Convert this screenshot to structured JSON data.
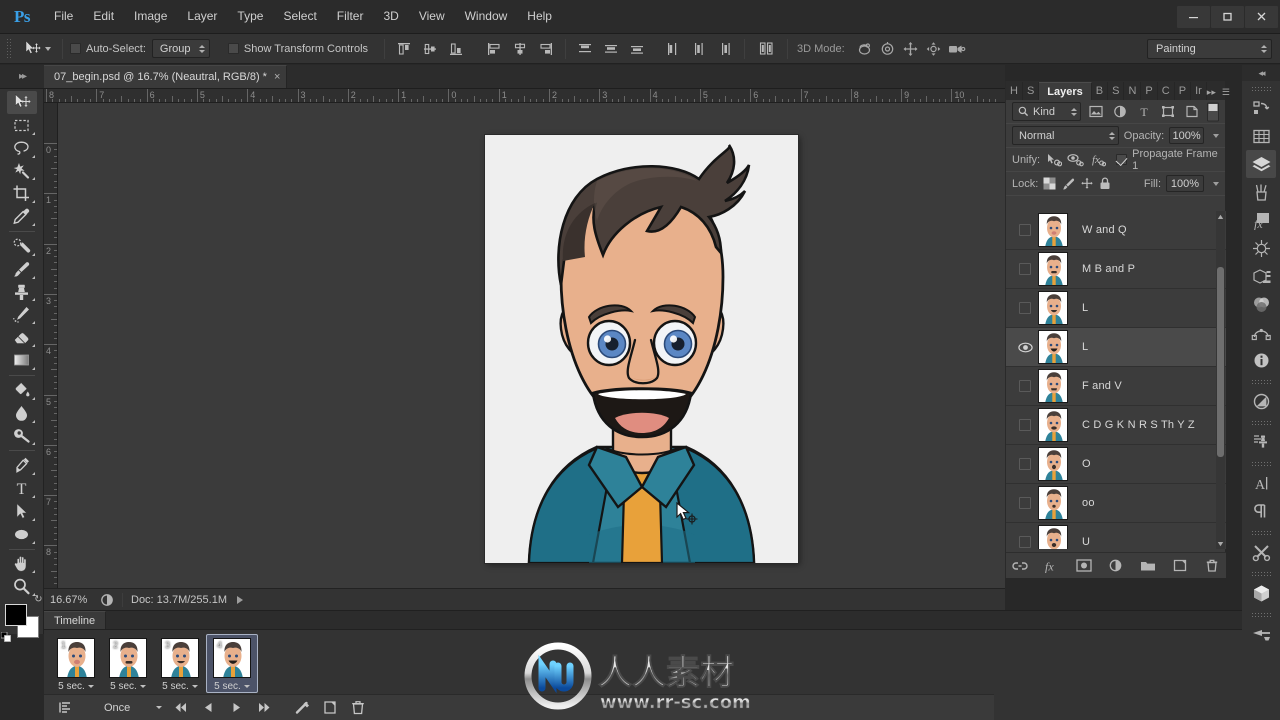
{
  "app": {
    "name": "Adobe Photoshop",
    "logo_text": "Ps"
  },
  "menubar": {
    "items": [
      {
        "label": "File"
      },
      {
        "label": "Edit"
      },
      {
        "label": "Image"
      },
      {
        "label": "Layer"
      },
      {
        "label": "Type"
      },
      {
        "label": "Select"
      },
      {
        "label": "Filter"
      },
      {
        "label": "3D"
      },
      {
        "label": "View"
      },
      {
        "label": "Window"
      },
      {
        "label": "Help"
      }
    ]
  },
  "window_controls": {
    "minimize": "minimize-icon",
    "maximize": "maximize-icon",
    "close": "close-icon"
  },
  "options_bar": {
    "tool": "move-tool",
    "auto_select_checked": false,
    "auto_select_label": "Auto-Select:",
    "auto_select_value": "Group",
    "show_transform_checked": false,
    "show_transform_label": "Show Transform Controls",
    "align_buttons": [
      "align-top-edges",
      "align-vertical-centers",
      "align-bottom-edges",
      "align-left-edges",
      "align-horizontal-centers",
      "align-right-edges"
    ],
    "distribute_buttons": [
      "distribute-top-edges",
      "distribute-vertical-centers",
      "distribute-bottom-edges",
      "distribute-left-edges",
      "distribute-horizontal-centers",
      "distribute-right-edges"
    ],
    "auto_align_button": "auto-align-layers",
    "mode3d_label": "3D Mode:",
    "mode3d_buttons": [
      "orbit-3d",
      "roll-3d",
      "pan-3d",
      "slide-3d",
      "zoom-3d-camera"
    ],
    "workspace": "Painting"
  },
  "document": {
    "tab_title": "07_begin.psd @ 16.7% (Neautral, RGB/8) *",
    "close_glyph": "×"
  },
  "rulers": {
    "unit_hint": "inches",
    "horizontal_labels": [
      "8",
      "7",
      "6",
      "5",
      "4",
      "3",
      "2",
      "1",
      "0",
      "1",
      "2",
      "3",
      "4",
      "5",
      "6",
      "7",
      "8",
      "9",
      "10"
    ],
    "vertical_labels": [
      "0",
      "1",
      "2",
      "3",
      "4",
      "5",
      "6",
      "7",
      "8"
    ]
  },
  "status_bar": {
    "zoom": "16.67%",
    "doc_info": "Doc: 13.7M/255.1M",
    "expand_glyph": "play-arrow-icon"
  },
  "toolbar": {
    "tools": [
      {
        "name": "move-tool",
        "active": true,
        "submenu": false
      },
      {
        "name": "rectangular-marquee-tool",
        "active": false,
        "submenu": true
      },
      {
        "name": "lasso-tool",
        "active": false,
        "submenu": true
      },
      {
        "name": "quick-selection-tool",
        "active": false,
        "submenu": true
      },
      {
        "name": "crop-tool",
        "active": false,
        "submenu": true
      },
      {
        "name": "eyedropper-tool",
        "active": false,
        "submenu": true
      },
      {
        "name": "spot-healing-brush-tool",
        "active": false,
        "submenu": true
      },
      {
        "name": "brush-tool",
        "active": false,
        "submenu": true
      },
      {
        "name": "clone-stamp-tool",
        "active": false,
        "submenu": true
      },
      {
        "name": "history-brush-tool",
        "active": false,
        "submenu": true
      },
      {
        "name": "eraser-tool",
        "active": false,
        "submenu": true
      },
      {
        "name": "gradient-tool",
        "active": false,
        "submenu": true
      },
      {
        "name": "blur-tool",
        "active": false,
        "submenu": true
      },
      {
        "name": "dodge-tool",
        "active": false,
        "submenu": true
      },
      {
        "name": "pen-tool",
        "active": false,
        "submenu": true
      },
      {
        "name": "horizontal-type-tool",
        "active": false,
        "submenu": true
      },
      {
        "name": "path-selection-tool",
        "active": false,
        "submenu": true
      },
      {
        "name": "ellipse-tool",
        "active": false,
        "submenu": true
      },
      {
        "name": "hand-tool",
        "active": false,
        "submenu": true
      },
      {
        "name": "zoom-tool",
        "active": false,
        "submenu": true
      }
    ],
    "foreground_color": "#000000",
    "background_color": "#ffffff"
  },
  "layers_panel": {
    "tabs": [
      {
        "label": "H",
        "active": false,
        "full": "History"
      },
      {
        "label": "S",
        "active": false,
        "full": "Swatches"
      },
      {
        "label": "Layers",
        "active": true,
        "full": "Layers"
      },
      {
        "label": "B",
        "active": false,
        "full": "Brushes"
      },
      {
        "label": "S",
        "active": false,
        "full": "Styles"
      },
      {
        "label": "N",
        "active": false,
        "full": "Navigator"
      },
      {
        "label": "P",
        "active": false,
        "full": "Paths"
      },
      {
        "label": "C",
        "active": false,
        "full": "Channels"
      },
      {
        "label": "P",
        "active": false,
        "full": "Properties"
      },
      {
        "label": "Ir",
        "active": false,
        "full": "Info"
      }
    ],
    "filter_kind": "Kind",
    "filter_icons": [
      "filter-pixel-layers",
      "filter-adjustment-layers",
      "filter-type-layers",
      "filter-shape-layers",
      "filter-smart-objects"
    ],
    "blend_mode": "Normal",
    "opacity_label": "Opacity:",
    "opacity_value": "100%",
    "unify_label": "Unify:",
    "unify_buttons": [
      "unify-position",
      "unify-visibility",
      "unify-style"
    ],
    "propagate_checked": true,
    "propagate_label": "Propagate Frame 1",
    "lock_label": "Lock:",
    "lock_buttons": [
      "lock-transparent-pixels",
      "lock-image-pixels",
      "lock-position",
      "lock-all"
    ],
    "fill_label": "Fill:",
    "fill_value": "100%",
    "layers": [
      {
        "name": "W and Q",
        "visible": false,
        "selected": false
      },
      {
        "name": "M B and P",
        "visible": false,
        "selected": false
      },
      {
        "name": "L",
        "visible": false,
        "selected": false
      },
      {
        "name": "L",
        "visible": true,
        "selected": true
      },
      {
        "name": "F and V",
        "visible": false,
        "selected": false
      },
      {
        "name": "C D G K N R S Th Y Z",
        "visible": false,
        "selected": false
      },
      {
        "name": "O",
        "visible": false,
        "selected": false
      },
      {
        "name": "oo",
        "visible": false,
        "selected": false
      },
      {
        "name": "U",
        "visible": false,
        "selected": false
      }
    ],
    "footer_buttons": [
      "link-layers-icon",
      "add-layer-style-icon",
      "add-layer-mask-icon",
      "new-adjustment-layer-icon",
      "new-group-icon",
      "new-layer-icon",
      "delete-layer-icon"
    ]
  },
  "icon_dock": {
    "buttons": [
      {
        "name": "history-icon",
        "active": false
      },
      {
        "name": "swatches-grid-icon",
        "active": false
      },
      {
        "name": "layers-icon",
        "active": true
      },
      {
        "name": "brushes-icon",
        "active": false
      },
      {
        "name": "styles-fx-icon",
        "active": false
      },
      {
        "name": "navigator-icon",
        "active": false
      },
      {
        "name": "properties-icon",
        "active": false
      },
      {
        "name": "channels-icon",
        "active": false
      },
      {
        "name": "paths-icon",
        "active": false
      },
      {
        "name": "info-icon",
        "active": false
      },
      {
        "name": "adjustments-icon",
        "active": false
      },
      {
        "name": "clone-source-icon",
        "active": false
      },
      {
        "name": "character-icon",
        "active": false
      },
      {
        "name": "paragraph-icon",
        "active": false
      },
      {
        "name": "tool-presets-icon",
        "active": false
      },
      {
        "name": "3d-icon",
        "active": false
      },
      {
        "name": "timeline-icon",
        "active": false
      }
    ]
  },
  "timeline": {
    "tab_label": "Timeline",
    "frames": [
      {
        "number": "1",
        "duration": "5 sec.",
        "selected": false
      },
      {
        "number": "2",
        "duration": "5 sec.",
        "selected": false
      },
      {
        "number": "3",
        "duration": "5 sec.",
        "selected": false
      },
      {
        "number": "4",
        "duration": "5 sec.",
        "selected": true
      }
    ],
    "loop_value": "Once",
    "controls": [
      "convert-to-video-timeline-icon",
      "select-first-frame-icon",
      "select-previous-frame-icon",
      "play-animation-icon",
      "select-next-frame-icon",
      "tween-frames-icon",
      "duplicate-frame-icon",
      "delete-frame-icon"
    ]
  },
  "watermark": {
    "chinese": "人人素材",
    "url": "www.rr-sc.com"
  },
  "artwork": {
    "description": "cartoon-man-portrait",
    "colors": {
      "background": "#efefef",
      "skin": "#e8b08c",
      "skin_shadow": "#d79a73",
      "hair": "#4a3f3a",
      "hair_dark": "#3a312d",
      "shirt": "#1f6f87",
      "shirt_light": "#2e8299",
      "collar_dark": "#17586c",
      "tie": "#e8a13a",
      "eye_blue": "#5b87c4",
      "eye_white": "#f2f4f7",
      "mouth_dark": "#1d1815",
      "tongue": "#e08d80",
      "outline": "#141414"
    }
  }
}
